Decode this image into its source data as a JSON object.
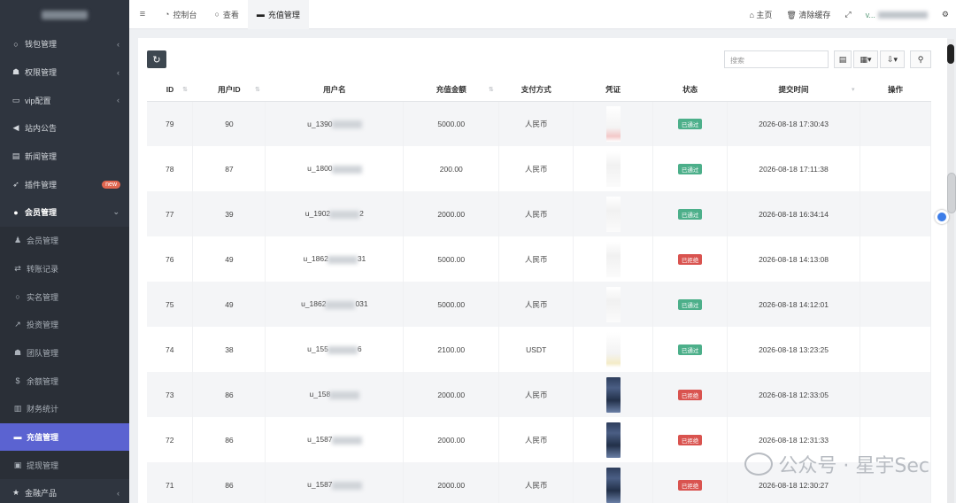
{
  "sidebar": {
    "items": [
      {
        "icon": "circle-icon",
        "glyph": "○",
        "label": "钱包管理",
        "arrow": "‹"
      },
      {
        "icon": "users-icon",
        "glyph": "☗",
        "label": "权限管理",
        "arrow": "‹"
      },
      {
        "icon": "card-icon",
        "glyph": "▭",
        "label": "vip配置",
        "arrow": "‹"
      },
      {
        "icon": "bullhorn-icon",
        "glyph": "◀",
        "label": "站内公告",
        "arrow": ""
      },
      {
        "icon": "newspaper-icon",
        "glyph": "▤",
        "label": "新闻管理",
        "arrow": ""
      },
      {
        "icon": "rocket-icon",
        "glyph": "➶",
        "label": "插件管理",
        "arrow": "",
        "badge": "new"
      },
      {
        "icon": "user-circle-icon",
        "glyph": "●",
        "label": "会员管理",
        "arrow": "⌄",
        "group": true
      },
      {
        "icon": "user-icon",
        "glyph": "♟",
        "label": "会员管理",
        "sub": true
      },
      {
        "icon": "exchange-icon",
        "glyph": "⇄",
        "label": "转账记录",
        "sub": true
      },
      {
        "icon": "circle-icon",
        "glyph": "○",
        "label": "实名管理",
        "sub": true
      },
      {
        "icon": "line-chart-icon",
        "glyph": "↗",
        "label": "投资管理",
        "sub": true
      },
      {
        "icon": "users-icon",
        "glyph": "☗",
        "label": "团队管理",
        "sub": true
      },
      {
        "icon": "dollar-icon",
        "glyph": "$",
        "label": "余额管理",
        "sub": true
      },
      {
        "icon": "bar-chart-icon",
        "glyph": "▥",
        "label": "财务统计",
        "sub": true
      },
      {
        "icon": "credit-card-icon",
        "glyph": "▬",
        "label": "充值管理",
        "sub": true,
        "active": true
      },
      {
        "icon": "money-icon",
        "glyph": "▣",
        "label": "提现管理",
        "sub": true
      },
      {
        "icon": "star-icon",
        "glyph": "★",
        "label": "金融产品",
        "arrow": "‹"
      }
    ]
  },
  "topbar": {
    "tabs": [
      {
        "icon": "dashboard-icon",
        "glyph": "◔",
        "label": "控制台"
      },
      {
        "icon": "circle-icon",
        "glyph": "○",
        "label": "查看"
      },
      {
        "icon": "credit-card-icon",
        "glyph": "▬",
        "label": "充值管理",
        "active": true
      }
    ],
    "home_label": "主页",
    "clear_cache_label": "清除缓存",
    "user_prefix": "v..."
  },
  "toolbar": {
    "search_placeholder": "搜索"
  },
  "table": {
    "columns": [
      "ID",
      "用户ID",
      "用户名",
      "充值金额",
      "支付方式",
      "凭证",
      "状态",
      "提交时间",
      "操作"
    ],
    "rows": [
      {
        "id": "79",
        "uid": "90",
        "username": "u_1390",
        "amount": "5000.00",
        "method": "人民币",
        "voucher": "pink",
        "status": "已通过",
        "status_color": "#4caf8a",
        "time": "2026-08-18 17:30:43"
      },
      {
        "id": "78",
        "uid": "87",
        "username": "u_1800",
        "amount": "200.00",
        "method": "人民币",
        "voucher": "light",
        "status": "已通过",
        "status_color": "#4caf8a",
        "time": "2026-08-18 17:11:38"
      },
      {
        "id": "77",
        "uid": "39",
        "username": "u_1902",
        "username_tail": "2",
        "amount": "2000.00",
        "method": "人民币",
        "voucher": "light",
        "status": "已通过",
        "status_color": "#4caf8a",
        "time": "2026-08-18 16:34:14"
      },
      {
        "id": "76",
        "uid": "49",
        "username": "u_1862",
        "username_tail": "31",
        "amount": "5000.00",
        "method": "人民币",
        "voucher": "light",
        "status": "已拒绝",
        "status_color": "#d9534f",
        "time": "2026-08-18 14:13:08"
      },
      {
        "id": "75",
        "uid": "49",
        "username": "u_1862",
        "username_tail": "031",
        "amount": "5000.00",
        "method": "人民币",
        "voucher": "light",
        "status": "已通过",
        "status_color": "#4caf8a",
        "time": "2026-08-18 14:12:01"
      },
      {
        "id": "74",
        "uid": "38",
        "username": "u_155",
        "username_tail": "6",
        "amount": "2100.00",
        "method": "USDT",
        "voucher": "yellow",
        "status": "已通过",
        "status_color": "#4caf8a",
        "time": "2026-08-18 13:23:25"
      },
      {
        "id": "73",
        "uid": "86",
        "username": "u_158",
        "amount": "2000.00",
        "method": "人民币",
        "voucher": "dark",
        "status": "已拒绝",
        "status_color": "#d9534f",
        "time": "2026-08-18 12:33:05"
      },
      {
        "id": "72",
        "uid": "86",
        "username": "u_1587",
        "amount": "2000.00",
        "method": "人民币",
        "voucher": "dark",
        "status": "已拒绝",
        "status_color": "#d9534f",
        "time": "2026-08-18 12:31:33"
      },
      {
        "id": "71",
        "uid": "86",
        "username": "u_1587",
        "amount": "2000.00",
        "method": "人民币",
        "voucher": "dark",
        "status": "已拒绝",
        "status_color": "#d9534f",
        "time": "2026-08-18 12:30:27"
      }
    ]
  },
  "watermark": "公众号 · 星宇Sec"
}
